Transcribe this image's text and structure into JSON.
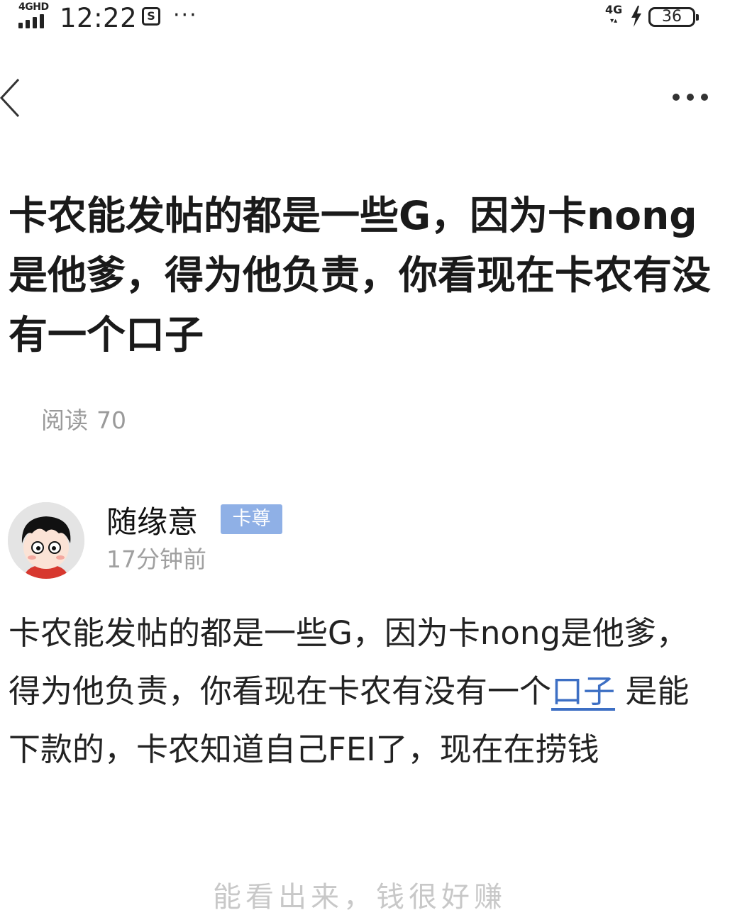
{
  "status_bar": {
    "signal_label": "4GHD",
    "time": "12:22",
    "notif_glyph": "S",
    "overflow": "···",
    "network": "4G",
    "network_arrows": "▾▴",
    "battery": "36"
  },
  "nav": {
    "back_icon": "chevron-left-icon",
    "more_icon": "more-horizontal-icon"
  },
  "post": {
    "title": "卡农能发帖的都是一些G，因为卡nong是他爹，得为他负责，你看现在卡农有没有一个口子",
    "reads_label": "阅读",
    "reads_count": "70"
  },
  "author": {
    "name": "随缘意",
    "badge": "卡尊",
    "time": "17分钟前",
    "badge_color": "#8fb0e6"
  },
  "content": {
    "part1": "卡农能发帖的都是一些G，因为卡nong是他爹，得为他负责，你看现在卡农有没有一个",
    "link_text": "口子",
    "part2": " 是能下款的，卡农知道自己FEI了，现在在捞钱",
    "link_color": "#3d6fc4"
  },
  "footer_partial": "能看出来，钱很好赚"
}
